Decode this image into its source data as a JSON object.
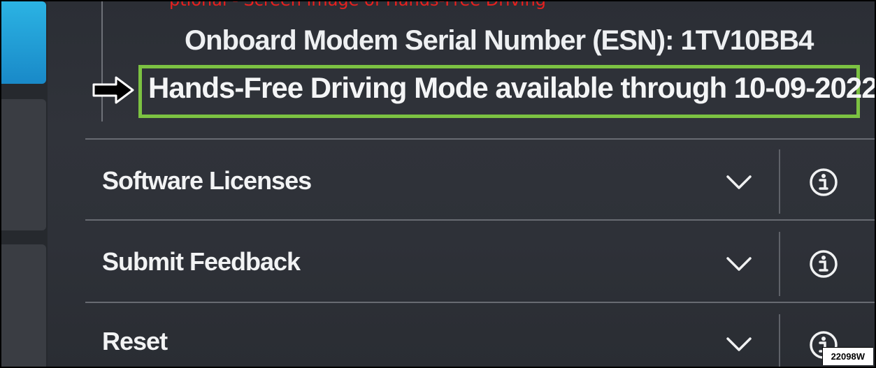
{
  "top_caption": "ptional - Screen image of Hands-Free Driving",
  "header": {
    "esn_line": "Onboard Modem Serial Number (ESN): 1TV10BB4",
    "hands_free_line": "Hands-Free Driving Mode available through 10-09-2022"
  },
  "rows": [
    {
      "label": "Software Licenses"
    },
    {
      "label": "Submit Feedback"
    },
    {
      "label": "Reset"
    }
  ],
  "figure_code": "22098W",
  "colors": {
    "highlight_box": "#7cc242",
    "active_rail": "#1f9bd6",
    "caption": "#e8201e"
  },
  "icons": {
    "row_expand": "chevron-down-icon",
    "row_info": "info-icon",
    "pointer": "arrow-right-icon"
  }
}
